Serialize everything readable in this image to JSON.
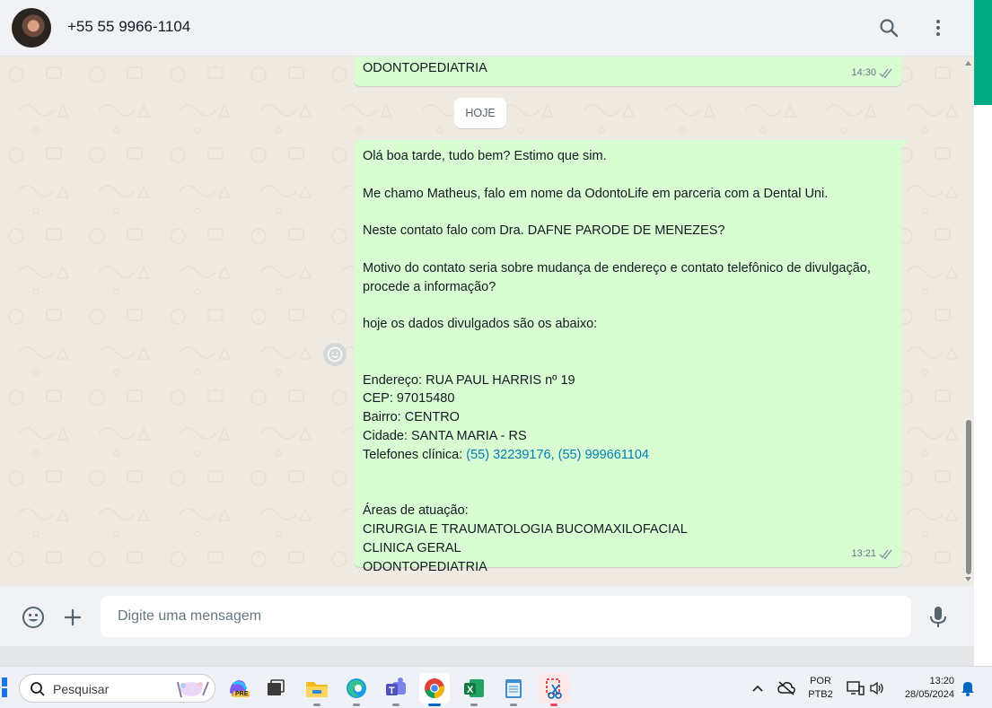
{
  "header": {
    "contact_name": "+55 55 9966-1104"
  },
  "chat": {
    "previous_message": {
      "text": "ODONTOPEDIATRIA",
      "time": "14:30"
    },
    "date_chip": "HOJE",
    "message": {
      "p1": "Olá boa tarde, tudo bem? Estimo que sim.",
      "p2": "Me chamo Matheus, falo em nome da OdontoLife em parceria com a Dental Uni.",
      "p3": "Neste contato falo com Dra. DAFNE PARODE DE MENEZES?",
      "p4": "Motivo do contato seria sobre mudança de endereço e contato telefônico de divulgação, procede a informação?",
      "p5": "hoje os dados divulgados são os abaixo:",
      "address": "Endereço: RUA PAUL HARRIS nº 19",
      "cep": "CEP: 97015480",
      "bairro": "Bairro: CENTRO",
      "cidade": "Cidade: SANTA MARIA - RS",
      "phones_label": "Telefones clínica: ",
      "phone1": "(55) 32239176",
      "phone_sep": ", ",
      "phone2": "(55) 999661104",
      "areas_title": "Áreas de atuação:",
      "area1": "CIRURGIA E TRAUMATOLOGIA BUCOMAXILOFACIAL",
      "area2": "CLINICA GERAL",
      "area3": "ODONTOPEDIATRIA",
      "time": "13:21"
    }
  },
  "compose": {
    "placeholder": "Digite uma mensagem"
  },
  "taskbar": {
    "search_label": "Pesquisar",
    "lang_line1": "POR",
    "lang_line2": "PTB2",
    "time": "13:20",
    "date": "28/05/2024",
    "copilot_badge": "PRE"
  },
  "colors": {
    "outgoing_bubble": "#d9fdd3",
    "accent": "#00a884",
    "link": "#027eb5"
  }
}
